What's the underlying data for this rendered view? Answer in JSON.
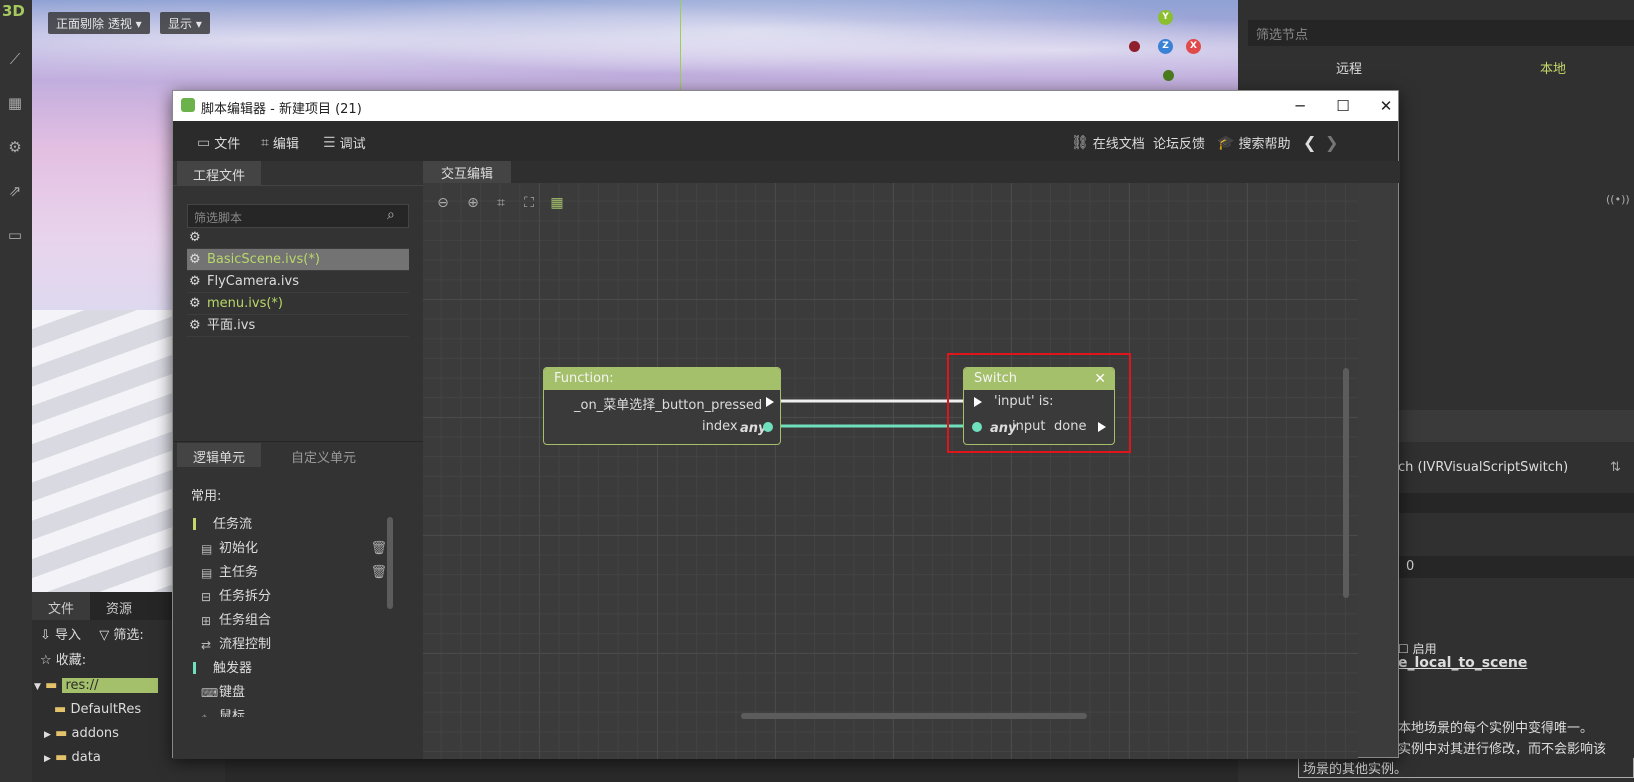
{
  "editor3d": {
    "label_3d": "3D",
    "view_mode_btn": "正面剔除 透视",
    "display_btn": "显示",
    "gizmo": {
      "y": "Y",
      "z": "Z",
      "x": "X"
    }
  },
  "file_dock": {
    "tabs": [
      "文件",
      "资源"
    ],
    "import_label": "导入",
    "filter_label": "筛选:",
    "favorites_label": "收藏:",
    "root": "res://",
    "folders": [
      "DefaultRes",
      "addons",
      "data"
    ]
  },
  "scene_panel": {
    "filter_placeholder": "筛选节点",
    "remote": "远程",
    "local": "本地"
  },
  "inspector": {
    "node_type": "ch (IVRVisualScriptSwitch)",
    "value": "0",
    "enable": "启用",
    "prop_name": "e_local_to_scene",
    "desc_line1": "本地场景的每个实例中变得唯一。",
    "desc_line2": "实例中对其进行修改，而不会影响该",
    "desc_line3": "场景的其他实例。"
  },
  "window": {
    "title": "脚本编辑器 - 新建项目 (21)",
    "controls": {
      "minimize": "─",
      "maximize": "☐",
      "close": "✕"
    },
    "menu": {
      "file": "文件",
      "edit": "编辑",
      "debug": "调试"
    },
    "links": {
      "online_docs": "在线文档",
      "forum": "论坛反馈",
      "search_help": "搜索帮助"
    }
  },
  "project_files": {
    "tab": "工程文件",
    "filter_placeholder": "筛选脚本",
    "files": [
      {
        "name": "",
        "modified": false,
        "selected": false
      },
      {
        "name": "BasicScene.ivs(*)",
        "modified": true,
        "selected": true
      },
      {
        "name": "FlyCamera.ivs",
        "modified": false,
        "selected": false
      },
      {
        "name": "menu.ivs(*)",
        "modified": true,
        "selected": false
      },
      {
        "name": "平面.ivs",
        "modified": false,
        "selected": false
      }
    ]
  },
  "units": {
    "tabs": [
      "逻辑单元",
      "自定义单元"
    ],
    "common_label": "常用:",
    "categories": [
      {
        "name": "任务流",
        "color": "#c5d76a",
        "items": [
          "初始化",
          "主任务",
          "任务拆分",
          "任务组合",
          "流程控制"
        ]
      },
      {
        "name": "触发器",
        "color": "#6fe0bd",
        "items": [
          "键盘",
          "鼠标"
        ]
      }
    ]
  },
  "graph": {
    "tab": "交互编辑",
    "function_node": {
      "title": "Function:",
      "output_exec": "_on_菜单选择_button_pressed",
      "output_data": "index",
      "output_type": "any"
    },
    "switch_node": {
      "title": "Switch",
      "input_exec": "'input' is:",
      "input_type": "any",
      "input_data": "input",
      "output_exec": "done"
    }
  }
}
